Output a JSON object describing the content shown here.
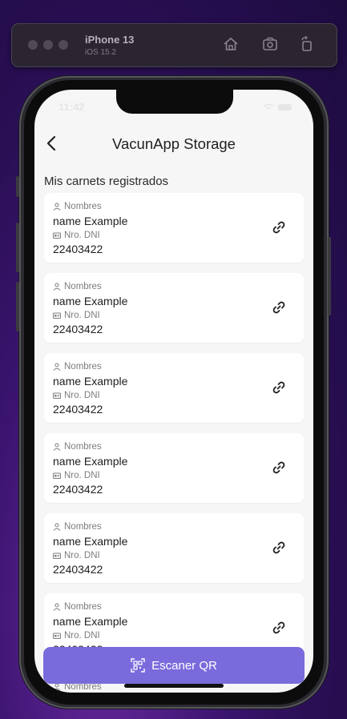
{
  "simulator": {
    "device_name": "iPhone 13",
    "os_version": "iOS 15.2"
  },
  "status_bar": {
    "time": "11:42"
  },
  "header": {
    "title": "VacunApp Storage"
  },
  "section": {
    "label": "Mis carnets registrados"
  },
  "cards": [
    {
      "name_label": "Nombres",
      "name_value": "name Example",
      "dni_label": "Nro. DNI",
      "dni_value": "22403422"
    },
    {
      "name_label": "Nombres",
      "name_value": "name Example",
      "dni_label": "Nro. DNI",
      "dni_value": "22403422"
    },
    {
      "name_label": "Nombres",
      "name_value": "name Example",
      "dni_label": "Nro. DNI",
      "dni_value": "22403422"
    },
    {
      "name_label": "Nombres",
      "name_value": "name Example",
      "dni_label": "Nro. DNI",
      "dni_value": "22403422"
    },
    {
      "name_label": "Nombres",
      "name_value": "name Example",
      "dni_label": "Nro. DNI",
      "dni_value": "22403422"
    },
    {
      "name_label": "Nombres",
      "name_value": "name Example",
      "dni_label": "Nro. DNI",
      "dni_value": "22403422"
    }
  ],
  "peek_label": "Nombres",
  "scan_button": {
    "label": "Escaner QR"
  },
  "icons": {
    "back": "chevron-left-icon",
    "person": "person-icon",
    "id_card": "id-card-icon",
    "link": "link-icon",
    "qr": "qr-scan-icon",
    "home": "home-icon",
    "screenshot": "screenshot-icon",
    "rotate": "rotate-icon"
  },
  "colors": {
    "accent": "#7a6bdc",
    "screen_bg": "#f6f6f6",
    "card_bg": "#ffffff"
  }
}
